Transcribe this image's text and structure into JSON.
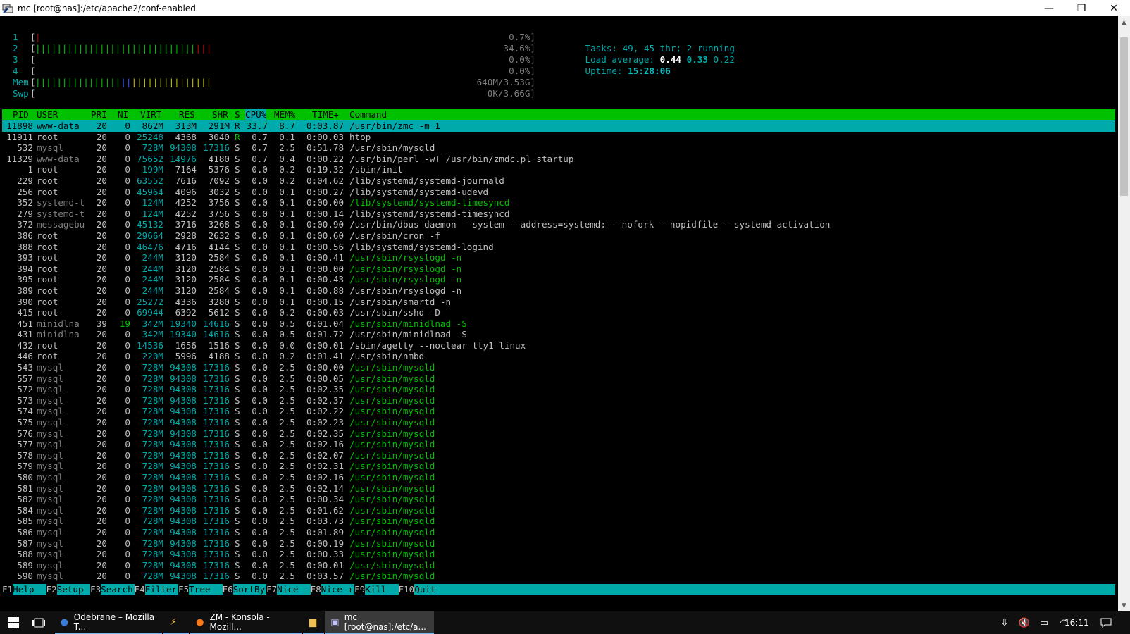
{
  "window": {
    "title": "mc [root@nas]:/etc/apache2/conf-enabled",
    "controls": {
      "minimize": "—",
      "maximize": "❐",
      "close": "✕"
    }
  },
  "meters": [
    {
      "label": "1",
      "bar_green": "",
      "bar_red": "|",
      "value": "0.7%]"
    },
    {
      "label": "2",
      "bar_green": "||||||||||||||||||||||||||||||",
      "bar_red": "|||",
      "value": "34.6%]"
    },
    {
      "label": "3",
      "bar_green": "",
      "bar_red": "",
      "value": "0.0%]"
    },
    {
      "label": "4",
      "bar_green": "",
      "bar_red": "",
      "value": "0.0%]"
    }
  ],
  "mem": {
    "label": "Mem",
    "bar_green": "||||||||||||||||",
    "bar_blue": "||",
    "bar_yellow": "|||||||||||||||",
    "value": "640M/3.53G]"
  },
  "swap": {
    "label": "Swp",
    "value": "0K/3.66G]"
  },
  "stats": {
    "tasks_label": "Tasks:",
    "tasks": "49,",
    "threads": "45",
    "thr_label": "thr;",
    "running": "2",
    "running_label": "running",
    "load_label": "Load average:",
    "load1": "0.44",
    "load5": "0.33",
    "load15": "0.22",
    "uptime_label": "Uptime:",
    "uptime": "15:28:06"
  },
  "columns": {
    "pid": "PID",
    "user": "USER",
    "pri": "PRI",
    "ni": "NI",
    "virt": "VIRT",
    "res": "RES",
    "shr": "SHR",
    "s": "S",
    "cpu": "CPU%",
    "mem": "MEM%",
    "time": "TIME+",
    "command": "Command"
  },
  "processes": [
    {
      "pid": "11898",
      "user": "www-data",
      "pri": "20",
      "ni": "0",
      "virt": "862M",
      "res": "313M",
      "shr": "291M",
      "s": "R",
      "cpu": "33.7",
      "mem": "8.7",
      "time": "0:03.87",
      "command": "/usr/bin/zmc -m 1",
      "thread": false,
      "selected": true
    },
    {
      "pid": "11911",
      "user": "root",
      "pri": "20",
      "ni": "0",
      "virt": "25248",
      "res": "4368",
      "shr": "3040",
      "s": "R",
      "cpu": "0.7",
      "mem": "0.1",
      "time": "0:00.03",
      "command": "htop",
      "thread": false
    },
    {
      "pid": "532",
      "user": "mysql",
      "pri": "20",
      "ni": "0",
      "virt": "728M",
      "res": "94308",
      "shr": "17316",
      "s": "S",
      "cpu": "0.7",
      "mem": "2.5",
      "time": "0:51.78",
      "command": "/usr/sbin/mysqld",
      "thread": false
    },
    {
      "pid": "11329",
      "user": "www-data",
      "pri": "20",
      "ni": "0",
      "virt": "75652",
      "res": "14976",
      "shr": "4180",
      "s": "S",
      "cpu": "0.7",
      "mem": "0.4",
      "time": "0:00.22",
      "command": "/usr/bin/perl -wT /usr/bin/zmdc.pl startup",
      "thread": false
    },
    {
      "pid": "1",
      "user": "root",
      "pri": "20",
      "ni": "0",
      "virt": "199M",
      "res": "7164",
      "shr": "5376",
      "s": "S",
      "cpu": "0.0",
      "mem": "0.2",
      "time": "0:19.32",
      "command": "/sbin/init",
      "thread": false
    },
    {
      "pid": "229",
      "user": "root",
      "pri": "20",
      "ni": "0",
      "virt": "63552",
      "res": "7616",
      "shr": "7092",
      "s": "S",
      "cpu": "0.0",
      "mem": "0.2",
      "time": "0:04.62",
      "command": "/lib/systemd/systemd-journald",
      "thread": false
    },
    {
      "pid": "256",
      "user": "root",
      "pri": "20",
      "ni": "0",
      "virt": "45964",
      "res": "4096",
      "shr": "3032",
      "s": "S",
      "cpu": "0.0",
      "mem": "0.1",
      "time": "0:00.27",
      "command": "/lib/systemd/systemd-udevd",
      "thread": false
    },
    {
      "pid": "352",
      "user": "systemd-t",
      "pri": "20",
      "ni": "0",
      "virt": "124M",
      "res": "4252",
      "shr": "3756",
      "s": "S",
      "cpu": "0.0",
      "mem": "0.1",
      "time": "0:00.00",
      "command": "/lib/systemd/systemd-timesyncd",
      "thread": true
    },
    {
      "pid": "279",
      "user": "systemd-t",
      "pri": "20",
      "ni": "0",
      "virt": "124M",
      "res": "4252",
      "shr": "3756",
      "s": "S",
      "cpu": "0.0",
      "mem": "0.1",
      "time": "0:00.14",
      "command": "/lib/systemd/systemd-timesyncd",
      "thread": false
    },
    {
      "pid": "372",
      "user": "messagebu",
      "pri": "20",
      "ni": "0",
      "virt": "45132",
      "res": "3716",
      "shr": "3268",
      "s": "S",
      "cpu": "0.0",
      "mem": "0.1",
      "time": "0:00.90",
      "command": "/usr/bin/dbus-daemon --system --address=systemd: --nofork --nopidfile --systemd-activation",
      "thread": false
    },
    {
      "pid": "386",
      "user": "root",
      "pri": "20",
      "ni": "0",
      "virt": "29664",
      "res": "2928",
      "shr": "2632",
      "s": "S",
      "cpu": "0.0",
      "mem": "0.1",
      "time": "0:00.60",
      "command": "/usr/sbin/cron -f",
      "thread": false
    },
    {
      "pid": "388",
      "user": "root",
      "pri": "20",
      "ni": "0",
      "virt": "46476",
      "res": "4716",
      "shr": "4144",
      "s": "S",
      "cpu": "0.0",
      "mem": "0.1",
      "time": "0:00.56",
      "command": "/lib/systemd/systemd-logind",
      "thread": false
    },
    {
      "pid": "393",
      "user": "root",
      "pri": "20",
      "ni": "0",
      "virt": "244M",
      "res": "3120",
      "shr": "2584",
      "s": "S",
      "cpu": "0.0",
      "mem": "0.1",
      "time": "0:00.41",
      "command": "/usr/sbin/rsyslogd -n",
      "thread": true
    },
    {
      "pid": "394",
      "user": "root",
      "pri": "20",
      "ni": "0",
      "virt": "244M",
      "res": "3120",
      "shr": "2584",
      "s": "S",
      "cpu": "0.0",
      "mem": "0.1",
      "time": "0:00.00",
      "command": "/usr/sbin/rsyslogd -n",
      "thread": true
    },
    {
      "pid": "395",
      "user": "root",
      "pri": "20",
      "ni": "0",
      "virt": "244M",
      "res": "3120",
      "shr": "2584",
      "s": "S",
      "cpu": "0.0",
      "mem": "0.1",
      "time": "0:00.43",
      "command": "/usr/sbin/rsyslogd -n",
      "thread": true
    },
    {
      "pid": "389",
      "user": "root",
      "pri": "20",
      "ni": "0",
      "virt": "244M",
      "res": "3120",
      "shr": "2584",
      "s": "S",
      "cpu": "0.0",
      "mem": "0.1",
      "time": "0:00.88",
      "command": "/usr/sbin/rsyslogd -n",
      "thread": false
    },
    {
      "pid": "390",
      "user": "root",
      "pri": "20",
      "ni": "0",
      "virt": "25272",
      "res": "4336",
      "shr": "3280",
      "s": "S",
      "cpu": "0.0",
      "mem": "0.1",
      "time": "0:00.15",
      "command": "/usr/sbin/smartd -n",
      "thread": false
    },
    {
      "pid": "415",
      "user": "root",
      "pri": "20",
      "ni": "0",
      "virt": "69944",
      "res": "6392",
      "shr": "5612",
      "s": "S",
      "cpu": "0.0",
      "mem": "0.2",
      "time": "0:00.03",
      "command": "/usr/sbin/sshd -D",
      "thread": false
    },
    {
      "pid": "451",
      "user": "minidlna",
      "pri": "39",
      "ni": "19",
      "virt": "342M",
      "res": "19340",
      "shr": "14616",
      "s": "S",
      "cpu": "0.0",
      "mem": "0.5",
      "time": "0:01.04",
      "command": "/usr/sbin/minidlnad -S",
      "thread": true
    },
    {
      "pid": "431",
      "user": "minidlna",
      "pri": "20",
      "ni": "0",
      "virt": "342M",
      "res": "19340",
      "shr": "14616",
      "s": "S",
      "cpu": "0.0",
      "mem": "0.5",
      "time": "0:01.72",
      "command": "/usr/sbin/minidlnad -S",
      "thread": false
    },
    {
      "pid": "432",
      "user": "root",
      "pri": "20",
      "ni": "0",
      "virt": "14536",
      "res": "1656",
      "shr": "1516",
      "s": "S",
      "cpu": "0.0",
      "mem": "0.0",
      "time": "0:00.01",
      "command": "/sbin/agetty --noclear tty1 linux",
      "thread": false
    },
    {
      "pid": "446",
      "user": "root",
      "pri": "20",
      "ni": "0",
      "virt": "220M",
      "res": "5996",
      "shr": "4188",
      "s": "S",
      "cpu": "0.0",
      "mem": "0.2",
      "time": "0:01.41",
      "command": "/usr/sbin/nmbd",
      "thread": false
    },
    {
      "pid": "543",
      "user": "mysql",
      "pri": "20",
      "ni": "0",
      "virt": "728M",
      "res": "94308",
      "shr": "17316",
      "s": "S",
      "cpu": "0.0",
      "mem": "2.5",
      "time": "0:00.00",
      "command": "/usr/sbin/mysqld",
      "thread": true
    },
    {
      "pid": "557",
      "user": "mysql",
      "pri": "20",
      "ni": "0",
      "virt": "728M",
      "res": "94308",
      "shr": "17316",
      "s": "S",
      "cpu": "0.0",
      "mem": "2.5",
      "time": "0:00.05",
      "command": "/usr/sbin/mysqld",
      "thread": true
    },
    {
      "pid": "572",
      "user": "mysql",
      "pri": "20",
      "ni": "0",
      "virt": "728M",
      "res": "94308",
      "shr": "17316",
      "s": "S",
      "cpu": "0.0",
      "mem": "2.5",
      "time": "0:02.35",
      "command": "/usr/sbin/mysqld",
      "thread": true
    },
    {
      "pid": "573",
      "user": "mysql",
      "pri": "20",
      "ni": "0",
      "virt": "728M",
      "res": "94308",
      "shr": "17316",
      "s": "S",
      "cpu": "0.0",
      "mem": "2.5",
      "time": "0:02.37",
      "command": "/usr/sbin/mysqld",
      "thread": true
    },
    {
      "pid": "574",
      "user": "mysql",
      "pri": "20",
      "ni": "0",
      "virt": "728M",
      "res": "94308",
      "shr": "17316",
      "s": "S",
      "cpu": "0.0",
      "mem": "2.5",
      "time": "0:02.22",
      "command": "/usr/sbin/mysqld",
      "thread": true
    },
    {
      "pid": "575",
      "user": "mysql",
      "pri": "20",
      "ni": "0",
      "virt": "728M",
      "res": "94308",
      "shr": "17316",
      "s": "S",
      "cpu": "0.0",
      "mem": "2.5",
      "time": "0:02.23",
      "command": "/usr/sbin/mysqld",
      "thread": true
    },
    {
      "pid": "576",
      "user": "mysql",
      "pri": "20",
      "ni": "0",
      "virt": "728M",
      "res": "94308",
      "shr": "17316",
      "s": "S",
      "cpu": "0.0",
      "mem": "2.5",
      "time": "0:02.35",
      "command": "/usr/sbin/mysqld",
      "thread": true
    },
    {
      "pid": "577",
      "user": "mysql",
      "pri": "20",
      "ni": "0",
      "virt": "728M",
      "res": "94308",
      "shr": "17316",
      "s": "S",
      "cpu": "0.0",
      "mem": "2.5",
      "time": "0:02.16",
      "command": "/usr/sbin/mysqld",
      "thread": true
    },
    {
      "pid": "578",
      "user": "mysql",
      "pri": "20",
      "ni": "0",
      "virt": "728M",
      "res": "94308",
      "shr": "17316",
      "s": "S",
      "cpu": "0.0",
      "mem": "2.5",
      "time": "0:02.07",
      "command": "/usr/sbin/mysqld",
      "thread": true
    },
    {
      "pid": "579",
      "user": "mysql",
      "pri": "20",
      "ni": "0",
      "virt": "728M",
      "res": "94308",
      "shr": "17316",
      "s": "S",
      "cpu": "0.0",
      "mem": "2.5",
      "time": "0:02.31",
      "command": "/usr/sbin/mysqld",
      "thread": true
    },
    {
      "pid": "580",
      "user": "mysql",
      "pri": "20",
      "ni": "0",
      "virt": "728M",
      "res": "94308",
      "shr": "17316",
      "s": "S",
      "cpu": "0.0",
      "mem": "2.5",
      "time": "0:02.16",
      "command": "/usr/sbin/mysqld",
      "thread": true
    },
    {
      "pid": "581",
      "user": "mysql",
      "pri": "20",
      "ni": "0",
      "virt": "728M",
      "res": "94308",
      "shr": "17316",
      "s": "S",
      "cpu": "0.0",
      "mem": "2.5",
      "time": "0:02.14",
      "command": "/usr/sbin/mysqld",
      "thread": true
    },
    {
      "pid": "582",
      "user": "mysql",
      "pri": "20",
      "ni": "0",
      "virt": "728M",
      "res": "94308",
      "shr": "17316",
      "s": "S",
      "cpu": "0.0",
      "mem": "2.5",
      "time": "0:00.34",
      "command": "/usr/sbin/mysqld",
      "thread": true
    },
    {
      "pid": "584",
      "user": "mysql",
      "pri": "20",
      "ni": "0",
      "virt": "728M",
      "res": "94308",
      "shr": "17316",
      "s": "S",
      "cpu": "0.0",
      "mem": "2.5",
      "time": "0:01.62",
      "command": "/usr/sbin/mysqld",
      "thread": true
    },
    {
      "pid": "585",
      "user": "mysql",
      "pri": "20",
      "ni": "0",
      "virt": "728M",
      "res": "94308",
      "shr": "17316",
      "s": "S",
      "cpu": "0.0",
      "mem": "2.5",
      "time": "0:03.73",
      "command": "/usr/sbin/mysqld",
      "thread": true
    },
    {
      "pid": "586",
      "user": "mysql",
      "pri": "20",
      "ni": "0",
      "virt": "728M",
      "res": "94308",
      "shr": "17316",
      "s": "S",
      "cpu": "0.0",
      "mem": "2.5",
      "time": "0:01.89",
      "command": "/usr/sbin/mysqld",
      "thread": true
    },
    {
      "pid": "587",
      "user": "mysql",
      "pri": "20",
      "ni": "0",
      "virt": "728M",
      "res": "94308",
      "shr": "17316",
      "s": "S",
      "cpu": "0.0",
      "mem": "2.5",
      "time": "0:00.19",
      "command": "/usr/sbin/mysqld",
      "thread": true
    },
    {
      "pid": "588",
      "user": "mysql",
      "pri": "20",
      "ni": "0",
      "virt": "728M",
      "res": "94308",
      "shr": "17316",
      "s": "S",
      "cpu": "0.0",
      "mem": "2.5",
      "time": "0:00.33",
      "command": "/usr/sbin/mysqld",
      "thread": true
    },
    {
      "pid": "589",
      "user": "mysql",
      "pri": "20",
      "ni": "0",
      "virt": "728M",
      "res": "94308",
      "shr": "17316",
      "s": "S",
      "cpu": "0.0",
      "mem": "2.5",
      "time": "0:00.01",
      "command": "/usr/sbin/mysqld",
      "thread": true
    },
    {
      "pid": "590",
      "user": "mysql",
      "pri": "20",
      "ni": "0",
      "virt": "728M",
      "res": "94308",
      "shr": "17316",
      "s": "S",
      "cpu": "0.0",
      "mem": "2.5",
      "time": "0:03.57",
      "command": "/usr/sbin/mysqld",
      "thread": true
    }
  ],
  "footer": [
    {
      "key": "F1",
      "label": "Help  "
    },
    {
      "key": "F2",
      "label": "Setup "
    },
    {
      "key": "F3",
      "label": "Search"
    },
    {
      "key": "F4",
      "label": "Filter"
    },
    {
      "key": "F5",
      "label": "Tree  "
    },
    {
      "key": "F6",
      "label": "SortBy"
    },
    {
      "key": "F7",
      "label": "Nice -"
    },
    {
      "key": "F8",
      "label": "Nice +"
    },
    {
      "key": "F9",
      "label": "Kill  "
    },
    {
      "key": "F10",
      "label": "Quit"
    }
  ],
  "taskbar": {
    "apps": [
      {
        "name": "firefox-mail",
        "label": "Odebrane – Mozilla T...",
        "icon": "thunderbird-icon"
      },
      {
        "name": "winscp",
        "label": "",
        "icon": "lightning-icon"
      },
      {
        "name": "firefox-zm",
        "label": "ZM - Konsola - Mozill...",
        "icon": "firefox-icon"
      },
      {
        "name": "explorer",
        "label": "",
        "icon": "folder-icon"
      },
      {
        "name": "putty",
        "label": "mc [root@nas]:/etc/a...",
        "icon": "putty-icon"
      }
    ],
    "clock": "16:11"
  },
  "colors": {
    "green": "#00c000",
    "cyan": "#00aaaa",
    "blue": "#3050ff",
    "red": "#c00000",
    "yellow": "#c0c000",
    "grey": "#808080",
    "white": "#c0c0c0",
    "bright": "#ffffff"
  }
}
